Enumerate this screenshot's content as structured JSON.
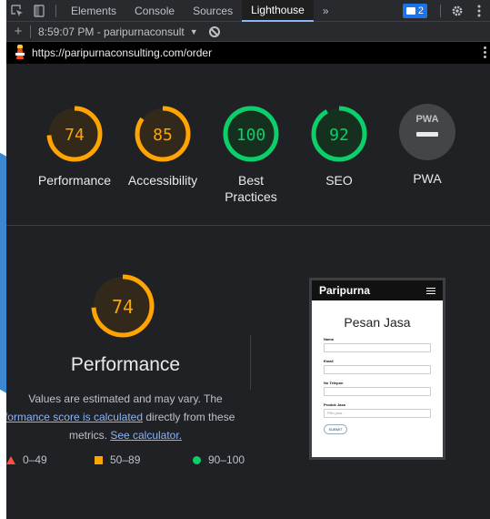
{
  "tabbar": {
    "tabs": [
      "Elements",
      "Console",
      "Sources",
      "Lighthouse"
    ],
    "active_tab": "Lighthouse",
    "more": "»",
    "issues_count": "2"
  },
  "report": {
    "selector": "8:59:07 PM - paripurnaconsult",
    "caret": "▼"
  },
  "url": "https://paripurnaconsulting.com/order",
  "scores": [
    {
      "label": "Performance",
      "value": 74,
      "color": "#ffa400"
    },
    {
      "label": "Accessibility",
      "value": 85,
      "color": "#ffa400"
    },
    {
      "label": "Best Practices",
      "value": 100,
      "color": "#0cce6b"
    },
    {
      "label": "SEO",
      "value": 92,
      "color": "#0cce6b"
    }
  ],
  "pwa": {
    "label": "PWA",
    "badge": "PWA"
  },
  "performance": {
    "score": 74,
    "title": "Performance",
    "desc_line1": "Values are estimated and may vary. The",
    "desc_link": "performance score is calculated",
    "desc_after": "directly from these metrics.",
    "calc_link": "See calculator."
  },
  "legend": {
    "fail": "0–49",
    "average": "50–89",
    "pass": "90–100"
  },
  "thumbnail": {
    "brand": "Paripurna",
    "heading": "Pesan Jasa",
    "fields": [
      "Nama",
      "Email",
      "No Telepon",
      "Produk Jasa"
    ],
    "select_placeholder": "Pilih jasa...",
    "submit": "SUBMIT"
  },
  "colors": {
    "average": "#ffa400",
    "pass": "#0cce6b",
    "fail": "#ff4e42"
  }
}
